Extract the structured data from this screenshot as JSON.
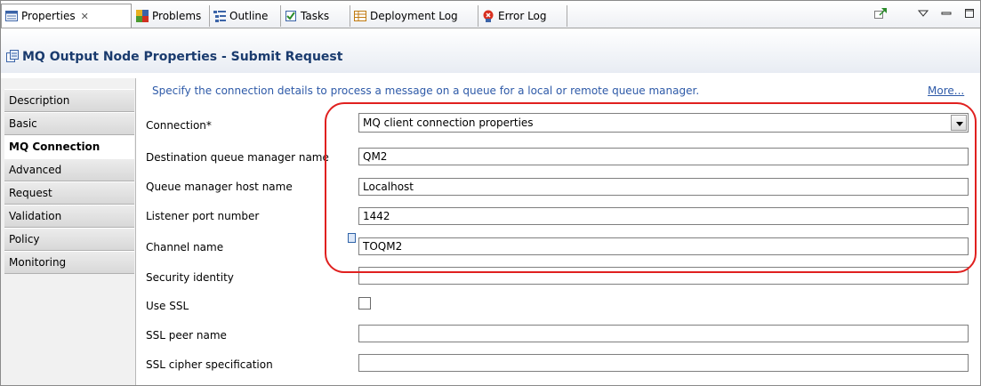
{
  "tabs": [
    {
      "label": "Properties",
      "icon": "properties-icon",
      "active": true,
      "close": "✕"
    },
    {
      "label": "Problems",
      "icon": "problems-icon"
    },
    {
      "label": "Outline",
      "icon": "outline-icon"
    },
    {
      "label": "Tasks",
      "icon": "tasks-icon"
    },
    {
      "label": "Deployment Log",
      "icon": "deployment-log-icon"
    },
    {
      "label": "Error Log",
      "icon": "error-log-icon"
    }
  ],
  "title": "MQ Output Node Properties - Submit Request",
  "nav": [
    {
      "label": "Description"
    },
    {
      "label": "Basic"
    },
    {
      "label": "MQ Connection",
      "selected": true
    },
    {
      "label": "Advanced"
    },
    {
      "label": "Request"
    },
    {
      "label": "Validation"
    },
    {
      "label": "Policy"
    },
    {
      "label": "Monitoring"
    }
  ],
  "hint": "Specify the connection details to process a message on a queue for a local or remote queue manager.",
  "more": "More...",
  "form": {
    "connection_label": "Connection*",
    "connection_value": "MQ client connection properties",
    "dest_qm_label": "Destination queue manager name",
    "dest_qm_value": "QM2",
    "host_label": "Queue manager host name",
    "host_value": "Localhost",
    "port_label": "Listener port number",
    "port_value": "1442",
    "channel_label": "Channel name",
    "channel_value": "TOQM2",
    "security_label": "Security identity",
    "security_value": "",
    "use_ssl_label": "Use SSL",
    "use_ssl_checked": false,
    "ssl_peer_label": "SSL peer name",
    "ssl_peer_value": "",
    "ssl_cipher_label": "SSL cipher specification",
    "ssl_cipher_value": ""
  },
  "colors": {
    "highlight": "#e0201f",
    "link": "#2e5aa8",
    "title": "#1a3b6e"
  }
}
